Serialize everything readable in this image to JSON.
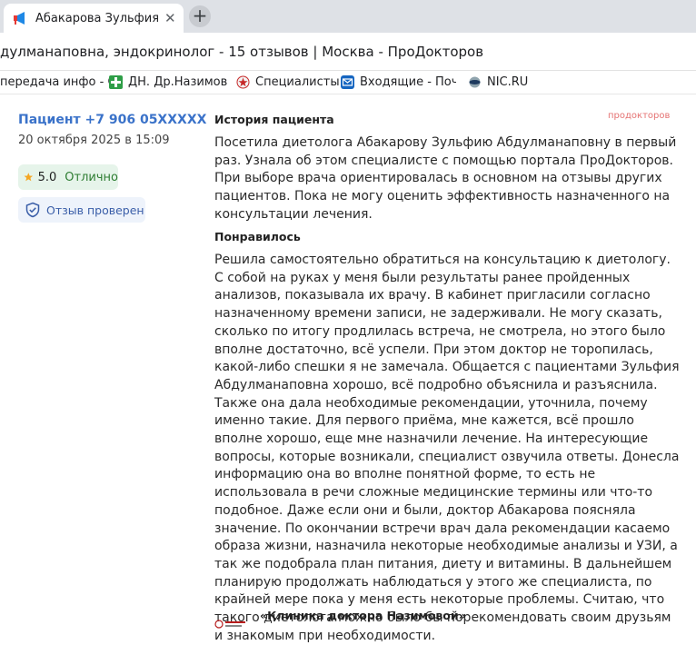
{
  "browser": {
    "tab_title": "Абакарова Зульфия Аб",
    "new_tab": "+",
    "close_glyph": "✕",
    "page_title": "дулманаповна, эндокринолог - 15 отзывов | Москва - ПроДокторов",
    "bookmarks": [
      {
        "label": "передача инфо - С"
      },
      {
        "label": "ДН. Др.Назимова"
      },
      {
        "label": "Специалисты"
      },
      {
        "label": "Входящие - Почта"
      },
      {
        "label": "NIC.RU"
      }
    ]
  },
  "review": {
    "author": "Пациент +7 906 05XXXXX",
    "date": "20 октября 2025 в 15:09",
    "rating_value": "5.0",
    "rating_text": "Отлично",
    "verified_text": "Отзыв проверен",
    "watermark": "продокторов",
    "history_title": "История пациента",
    "history_text": "Посетила диетолога Абакарову Зульфию Абдулманаповну в первый раз. Узнала об этом специалисте с помощью портала ПроДокторов. При выборе врача ориентировалась в основном на отзывы других пациентов. Пока не могу оценить эффективность назначенного на консультации лечения.",
    "liked_title": "Понравилось",
    "liked_text": "Решила самостоятельно обратиться на консультацию к диетологу. С собой на руках у меня были результаты ранее пройденных анализов, показывала их врачу. В кабинет пригласили согласно назначенному времени записи, не задерживали. Не могу сказать, сколько по итогу продлилась встреча, не смотрела, но этого было вполне достаточно, всё успели. При этом доктор не торопилась, какой-либо спешки я не замечала. Общается с пациентами Зульфия Абдулманаповна хорошо, всё подробно объяснила и разъяснила. Также она дала необходимые рекомендации, уточнила, почему именно такие. Для первого приёма, мне кажется, всё прошло вполне хорошо, еще мне назначили лечение. На интересующие вопросы, которые возникали, специалист озвучила ответы. Донесла информацию она во вполне понятной форме, то есть не использовала в речи сложные медицинские термины или что-то подобное. Даже если они и были, доктор Абакарова поясняла значение. По окончании встречи врач дала рекомендации касаемо образа жизни, назначила некоторые необходимые анализы и УЗИ, а так же подобрала план питания, диету и витамины. В дальнейшем планирую продолжать наблюдаться у этого же специалиста, по крайней мере пока у меня есть некоторые проблемы. Считаю, что такого диетолога можно было бы порекомендовать своим друзьям и знакомым при необходимости.",
    "clinic_name": "«Клиника доктора Назимовой»"
  },
  "icons": {
    "tab": "megaphone-icon",
    "rating": "star-icon",
    "verified": "shield-check-icon",
    "bookmark_1": "bookmark-page-icon",
    "bookmark_2": "green-cross-icon",
    "bookmark_3": "red-star-icon",
    "bookmark_4": "mail-icon",
    "bookmark_5": "nic-icon",
    "clinic": "clinic-logo-icon"
  },
  "colors": {
    "accent_blue": "#3a72c9",
    "rating_green": "#2e7d32",
    "rating_bg": "#e6f4ea",
    "star": "#f5a623"
  }
}
